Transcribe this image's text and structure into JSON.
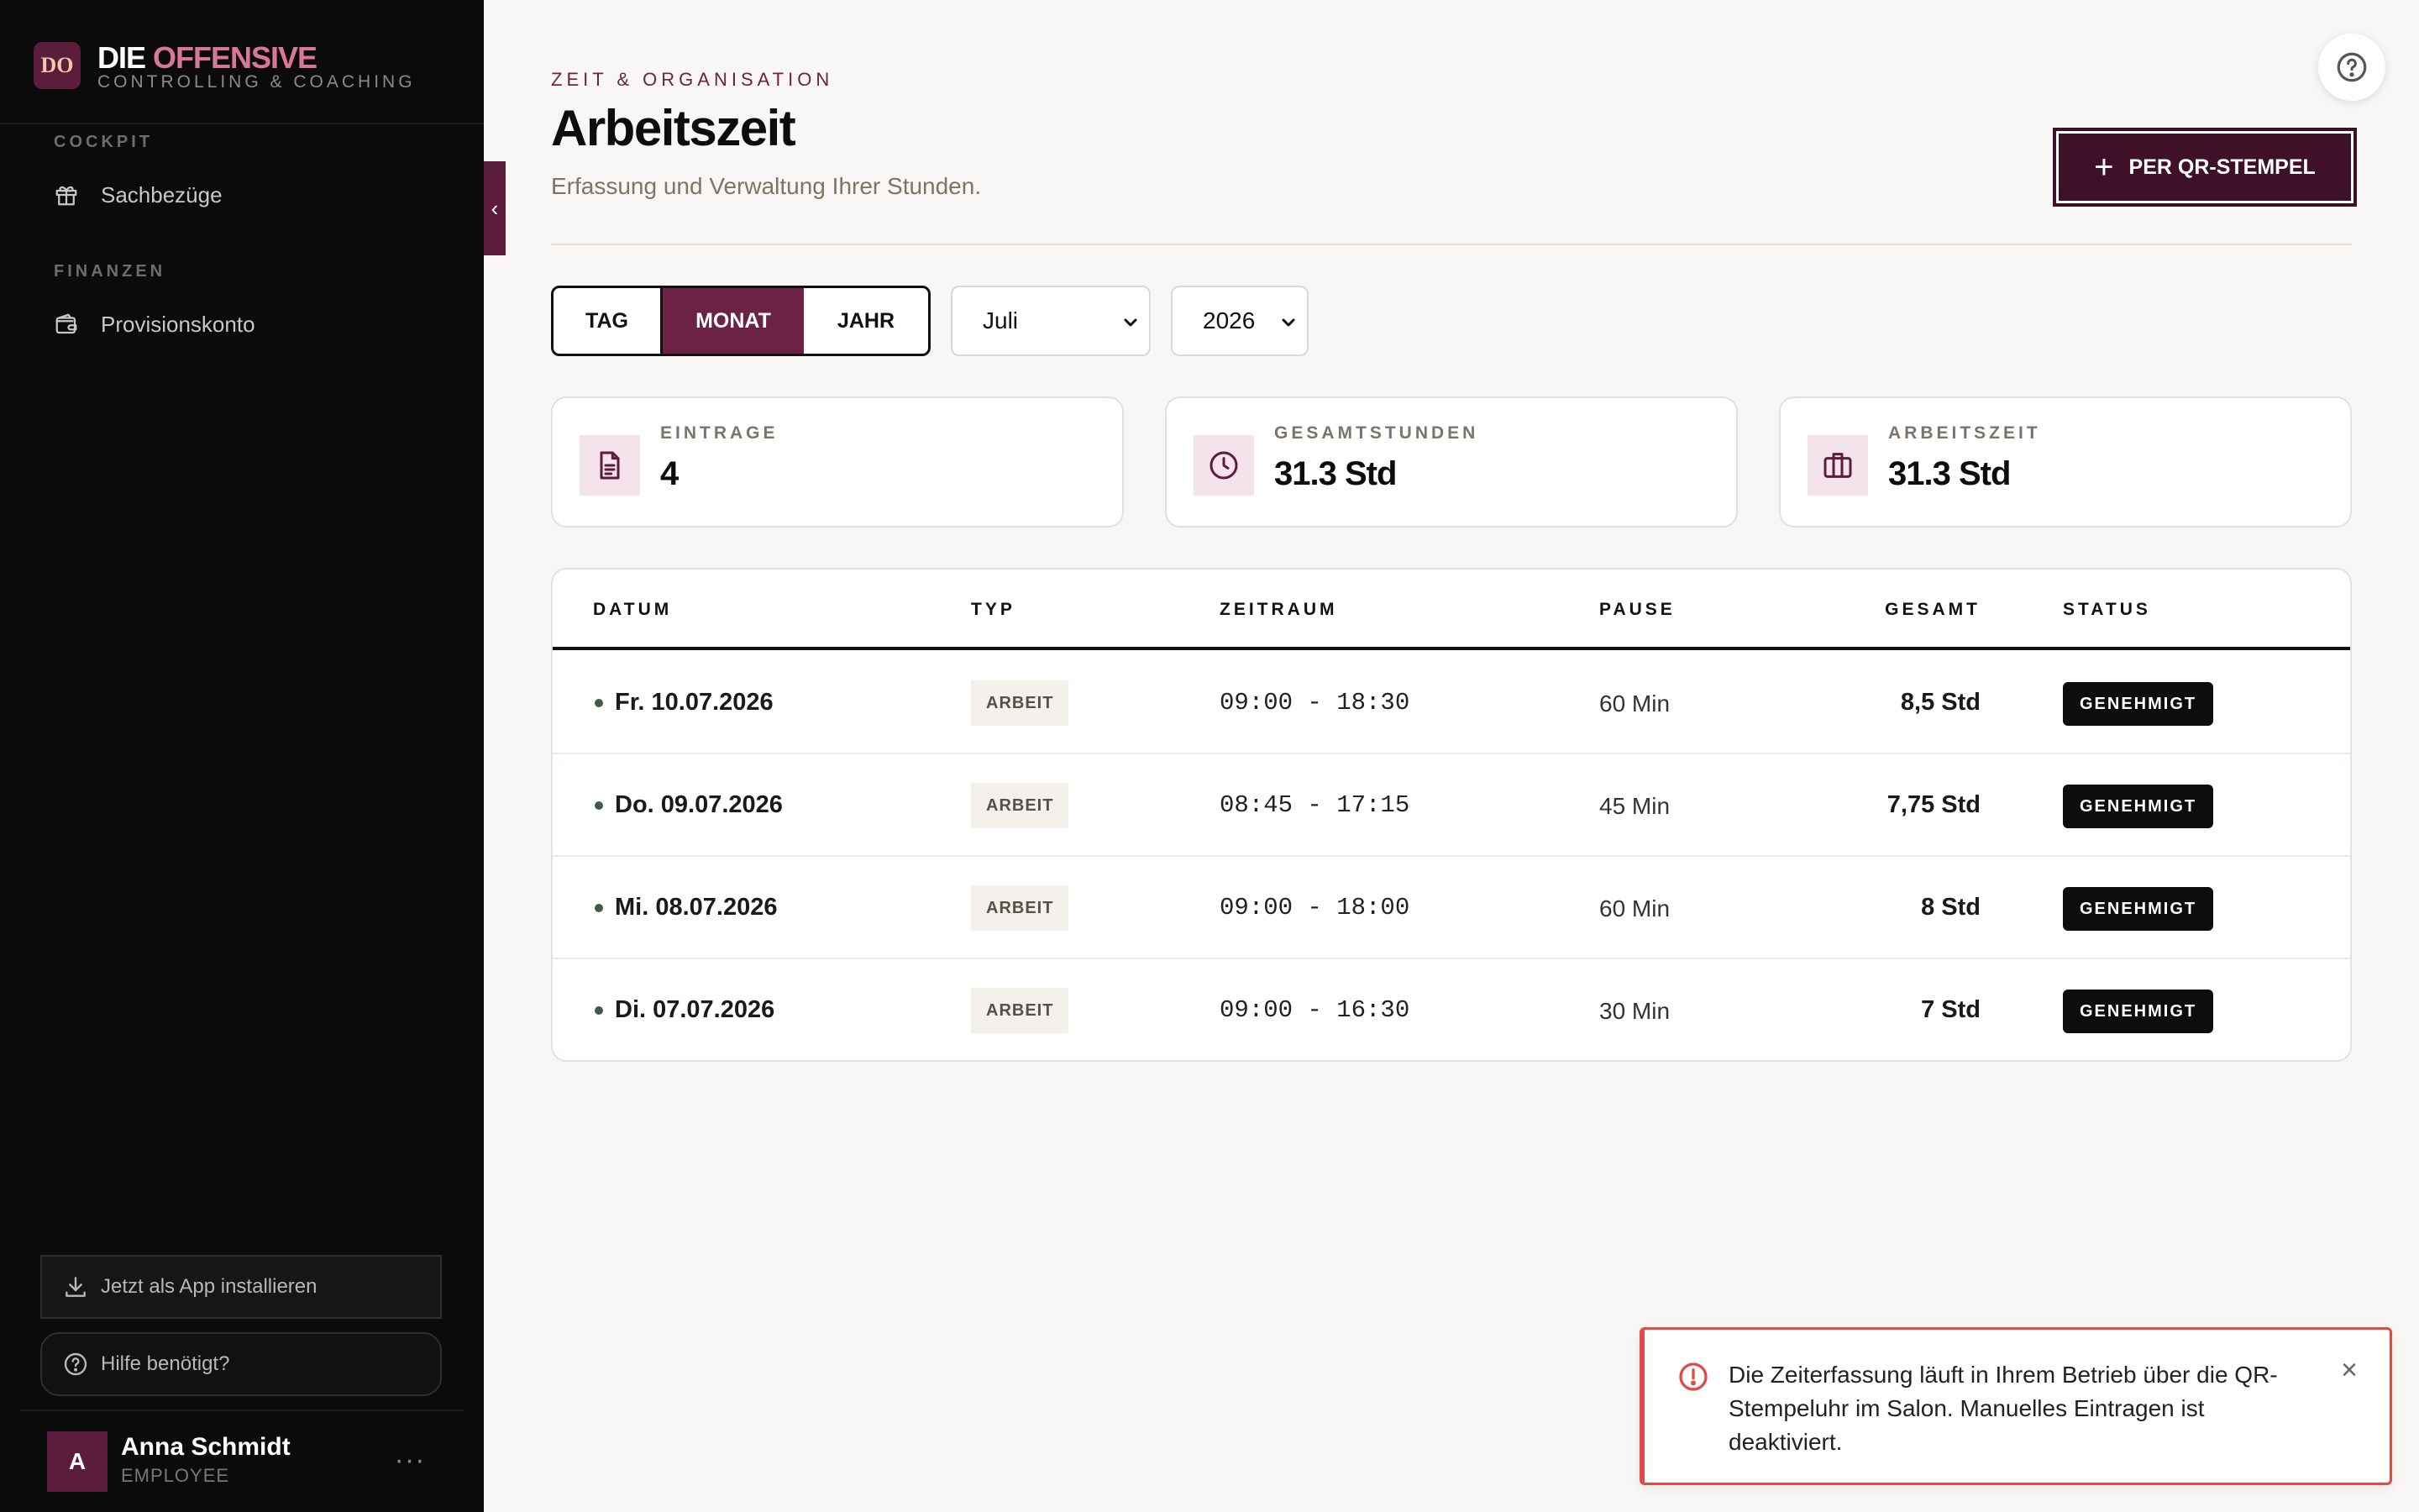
{
  "brand": {
    "logo": "DO",
    "name_main": "DIE",
    "name_accent": "OFFENSIVE",
    "tagline": "CONTROLLING & COACHING"
  },
  "sidebar": {
    "sections": [
      {
        "label": "COCKPIT",
        "items": [
          {
            "label": "Sachbezüge",
            "icon": "gift-icon"
          }
        ]
      },
      {
        "label": "FINANZEN",
        "items": [
          {
            "label": "Provisionskonto",
            "icon": "wallet-icon"
          }
        ]
      }
    ],
    "install_label": "Jetzt als App installieren",
    "help_label": "Hilfe benötigt?",
    "user": {
      "initial": "A",
      "name": "Anna Schmidt",
      "role": "EMPLOYEE",
      "menu": "···"
    },
    "collapse_glyph": "‹"
  },
  "header": {
    "eyebrow": "ZEIT & ORGANISATION",
    "title": "Arbeitszeit",
    "subtitle": "Erfassung und Verwaltung Ihrer Stunden.",
    "qr_button": "PER QR-STEMPEL",
    "qr_plus": "+"
  },
  "filters": {
    "view_options": [
      "TAG",
      "MONAT",
      "JAHR"
    ],
    "active_view": "MONAT",
    "month": "Juli",
    "year": "2026"
  },
  "stats": [
    {
      "label": "EINTRAGE",
      "value": "4",
      "icon": "document-icon"
    },
    {
      "label": "GESAMTSTUNDEN",
      "value": "31.3 Std",
      "icon": "clock-icon"
    },
    {
      "label": "ARBEITSZEIT",
      "value": "31.3 Std",
      "icon": "briefcase-icon"
    }
  ],
  "table": {
    "columns": [
      "DATUM",
      "TYP",
      "ZEITRAUM",
      "PAUSE",
      "GESAMT",
      "STATUS"
    ],
    "rows": [
      {
        "datum": "Fr. 10.07.2026",
        "typ": "ARBEIT",
        "zeitraum": "09:00 - 18:30",
        "pause": "60 Min",
        "gesamt": "8,5 Std",
        "status": "GENEHMIGT"
      },
      {
        "datum": "Do. 09.07.2026",
        "typ": "ARBEIT",
        "zeitraum": "08:45 - 17:15",
        "pause": "45 Min",
        "gesamt": "7,75 Std",
        "status": "GENEHMIGT"
      },
      {
        "datum": "Mi. 08.07.2026",
        "typ": "ARBEIT",
        "zeitraum": "09:00 - 18:00",
        "pause": "60 Min",
        "gesamt": "8 Std",
        "status": "GENEHMIGT"
      },
      {
        "datum": "Di. 07.07.2026",
        "typ": "ARBEIT",
        "zeitraum": "09:00 - 16:30",
        "pause": "30 Min",
        "gesamt": "7 Std",
        "status": "GENEHMIGT"
      }
    ]
  },
  "toast": {
    "message": "Die Zeiterfassung läuft in Ihrem Betrieb über die QR-Stempeluhr im Salon. Manuelles Eintragen ist deaktiviert.",
    "close": "×"
  },
  "colors": {
    "brand": "#6b2245",
    "sidebar_bg": "#0b0b0b",
    "accent_pink": "#d97795",
    "error": "#e24a4a"
  }
}
